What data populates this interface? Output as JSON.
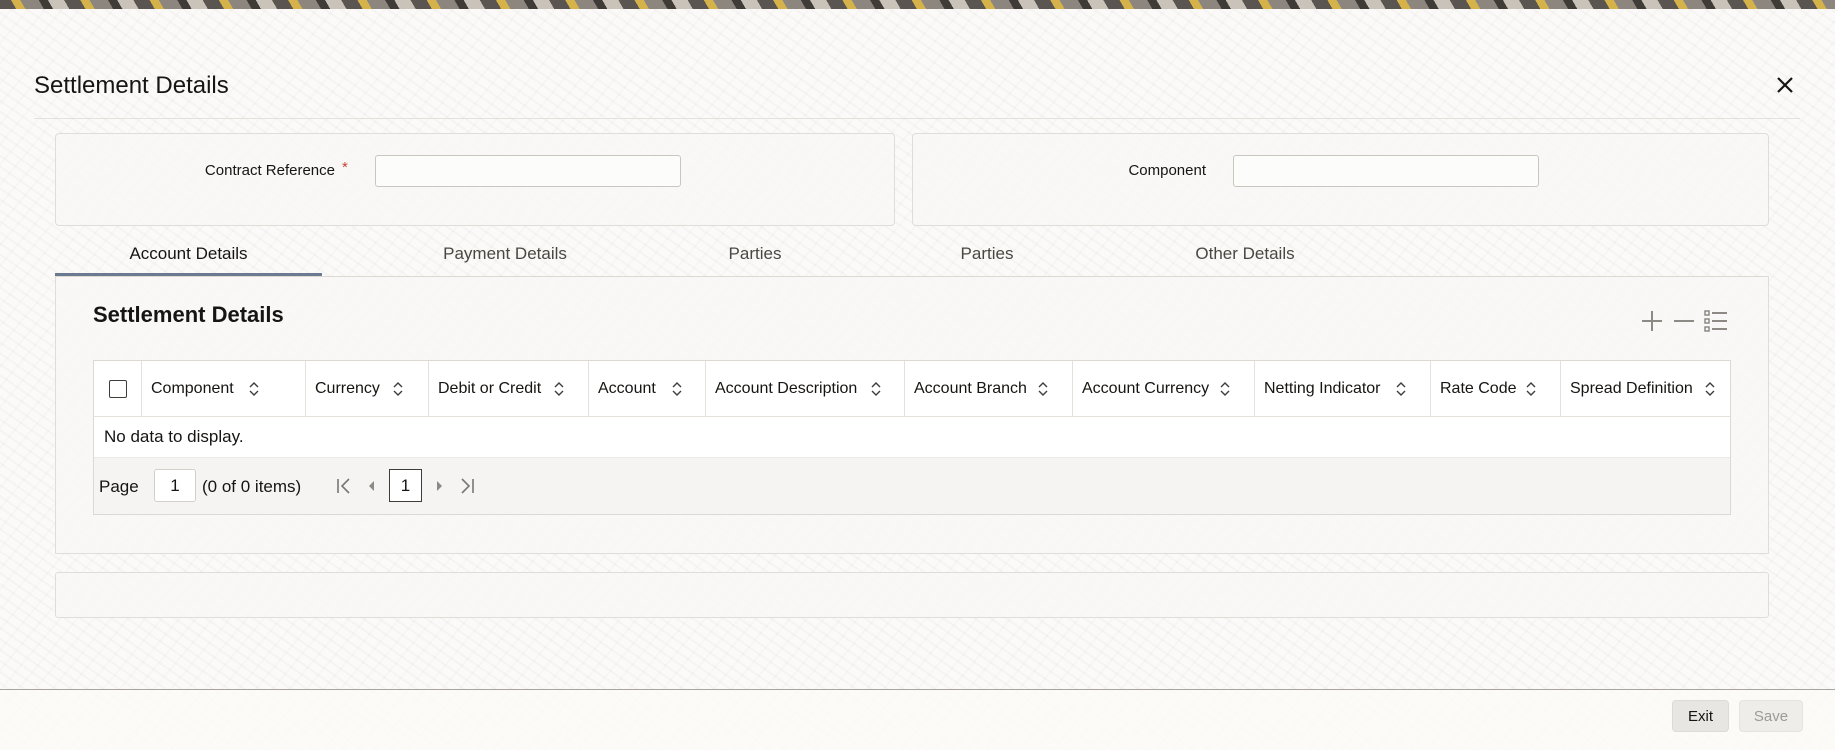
{
  "dialog": {
    "title": "Settlement Details",
    "close_icon": "close-icon"
  },
  "header_form": {
    "contract_reference": {
      "label": "Contract Reference",
      "required_marker": "*",
      "value": ""
    },
    "component": {
      "label": "Component",
      "value": ""
    }
  },
  "tabs": [
    {
      "label": "Account Details",
      "active": true
    },
    {
      "label": "Payment Details",
      "active": false
    },
    {
      "label": "Parties",
      "active": false
    },
    {
      "label": "Parties",
      "active": false
    },
    {
      "label": "Other Details",
      "active": false
    }
  ],
  "section": {
    "title": "Settlement Details",
    "toolbar": {
      "add_icon": "plus-icon",
      "remove_icon": "minus-icon",
      "view_icon": "list-view-icon"
    }
  },
  "grid": {
    "columns": [
      "Component",
      "Currency",
      "Debit or Credit",
      "Account",
      "Account Description",
      "Account Branch",
      "Account Currency",
      "Netting Indicator",
      "Rate Code",
      "Spread Definition"
    ],
    "empty_message": "No data to display.",
    "pager": {
      "page_label": "Page",
      "page_input": "1",
      "count_text": "(0 of 0 items)",
      "current_page": "1"
    }
  },
  "footer": {
    "exit_label": "Exit",
    "save_label": "Save"
  },
  "colors": {
    "accent_tab_underline": "#6b7a90",
    "required": "#c74634"
  }
}
